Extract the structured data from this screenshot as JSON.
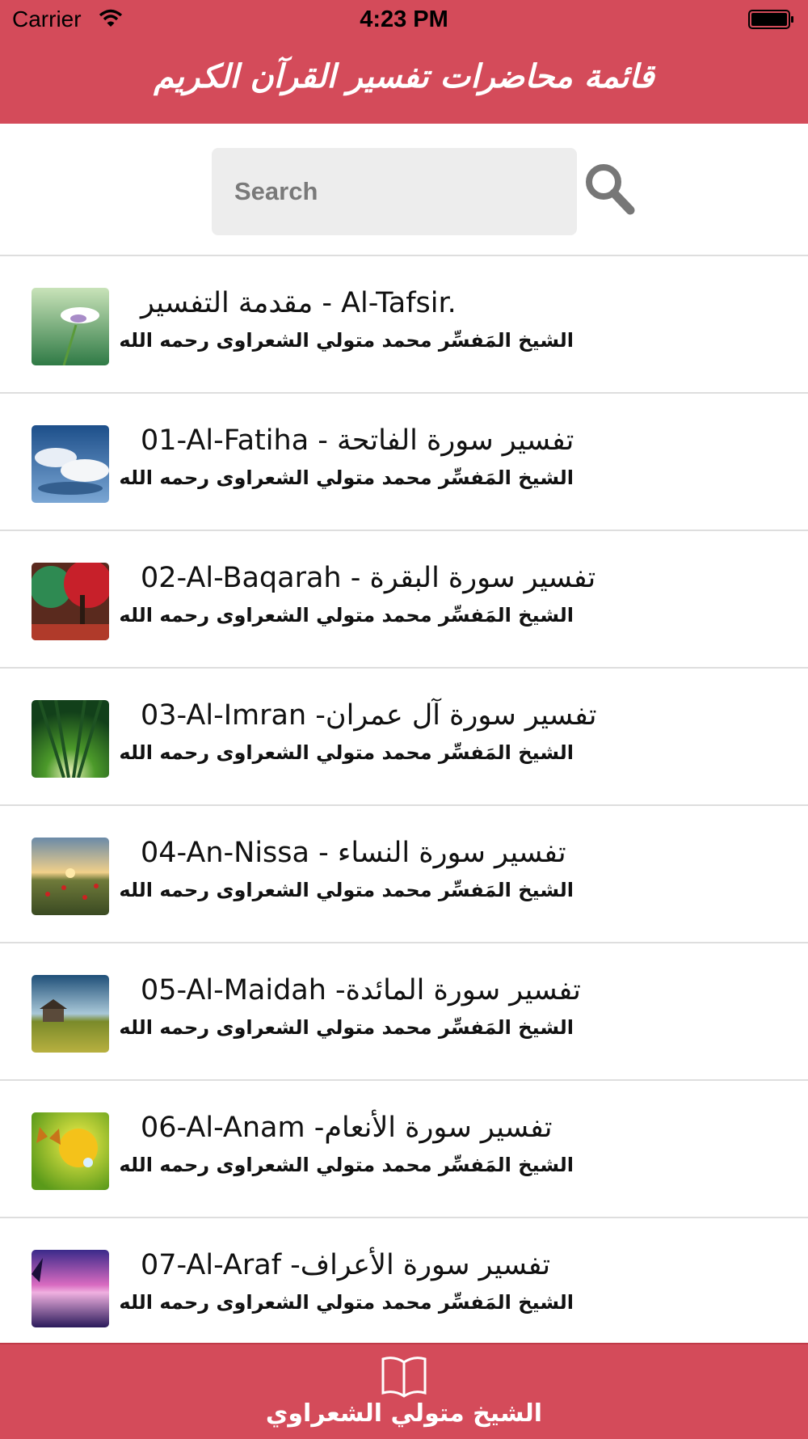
{
  "status_bar": {
    "carrier": "Carrier",
    "time": "4:23 PM"
  },
  "header": {
    "title": "قائمة محاضرات تفسير القرآن الكريم"
  },
  "search": {
    "placeholder": "Search"
  },
  "list": {
    "items": [
      {
        "title": "مقدمة التفسير - Al-Tafsir.",
        "subtitle": "الشيخ المَفسِّر محمد متولي الشعراوى رحمه الله",
        "thumb": "flower"
      },
      {
        "title": "01-Al-Fatiha - تفسير سورة الفاتحة",
        "subtitle": "الشيخ المَفسِّر محمد متولي الشعراوى رحمه الله",
        "thumb": "sky"
      },
      {
        "title": "02-Al-Baqarah - تفسير سورة البقرة",
        "subtitle": "الشيخ المَفسِّر محمد متولي الشعراوى رحمه الله",
        "thumb": "autumn"
      },
      {
        "title": "03-Al-Imran -تفسير سورة آل عمران",
        "subtitle": "الشيخ المَفسِّر محمد متولي الشعراوى رحمه الله",
        "thumb": "forest"
      },
      {
        "title": "04-An-Nissa - تفسير سورة النساء",
        "subtitle": "الشيخ المَفسِّر محمد متولي الشعراوى رحمه الله",
        "thumb": "field"
      },
      {
        "title": "05-Al-Maidah -تفسير سورة المائدة",
        "subtitle": "الشيخ المَفسِّر محمد متولي الشعراوى رحمه الله",
        "thumb": "house"
      },
      {
        "title": "06-Al-Anam -تفسير سورة الأنعام",
        "subtitle": "الشيخ المَفسِّر محمد متولي الشعراوى رحمه الله",
        "thumb": "butterfly"
      },
      {
        "title": "07-Al-Araf -تفسير سورة الأعراف",
        "subtitle": "الشيخ المَفسِّر محمد متولي الشعراوى رحمه الله",
        "thumb": "sunset"
      }
    ]
  },
  "tab_bar": {
    "label": "الشيخ متولي الشعراوي",
    "icon": "book-icon"
  },
  "colors": {
    "accent": "#d44b5a",
    "separator": "#dedede",
    "search_bg": "#ededed"
  }
}
